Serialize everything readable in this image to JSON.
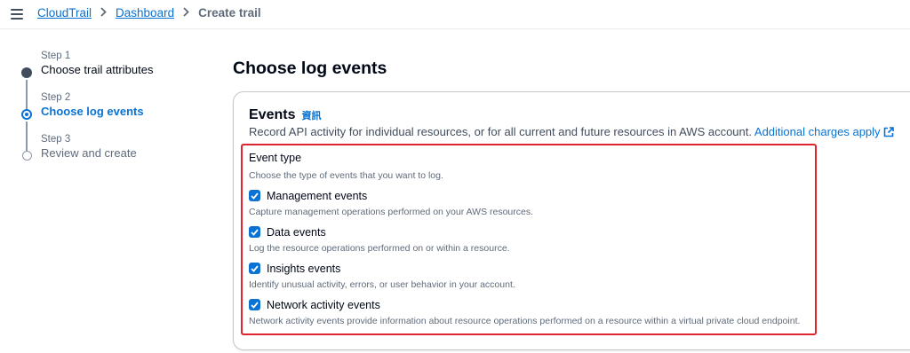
{
  "breadcrumb": {
    "items": [
      "CloudTrail",
      "Dashboard"
    ],
    "current": "Create trail"
  },
  "steps": [
    {
      "number": "Step 1",
      "label": "Choose trail attributes",
      "state": "done"
    },
    {
      "number": "Step 2",
      "label": "Choose log events",
      "state": "current"
    },
    {
      "number": "Step 3",
      "label": "Review and create",
      "state": "pending"
    }
  ],
  "main": {
    "title": "Choose log events",
    "panel": {
      "title": "Events",
      "info": "資訊",
      "description": "Record API activity for individual resources, or for all current and future resources in AWS account.",
      "charges_link": "Additional charges apply",
      "event_type": {
        "title": "Event type",
        "description": "Choose the type of events that you want to log.",
        "options": [
          {
            "label": "Management events",
            "description": "Capture management operations performed on your AWS resources.",
            "checked": true
          },
          {
            "label": "Data events",
            "description": "Log the resource operations performed on or within a resource.",
            "checked": true
          },
          {
            "label": "Insights events",
            "description": "Identify unusual activity, errors, or user behavior in your account.",
            "checked": true
          },
          {
            "label": "Network activity events",
            "description": "Network activity events provide information about resource operations performed on a resource within a virtual private cloud endpoint.",
            "checked": true
          }
        ]
      }
    }
  },
  "colors": {
    "link": "#0972d3",
    "highlight_border": "#e0242f",
    "checkbox": "#0972d3"
  }
}
